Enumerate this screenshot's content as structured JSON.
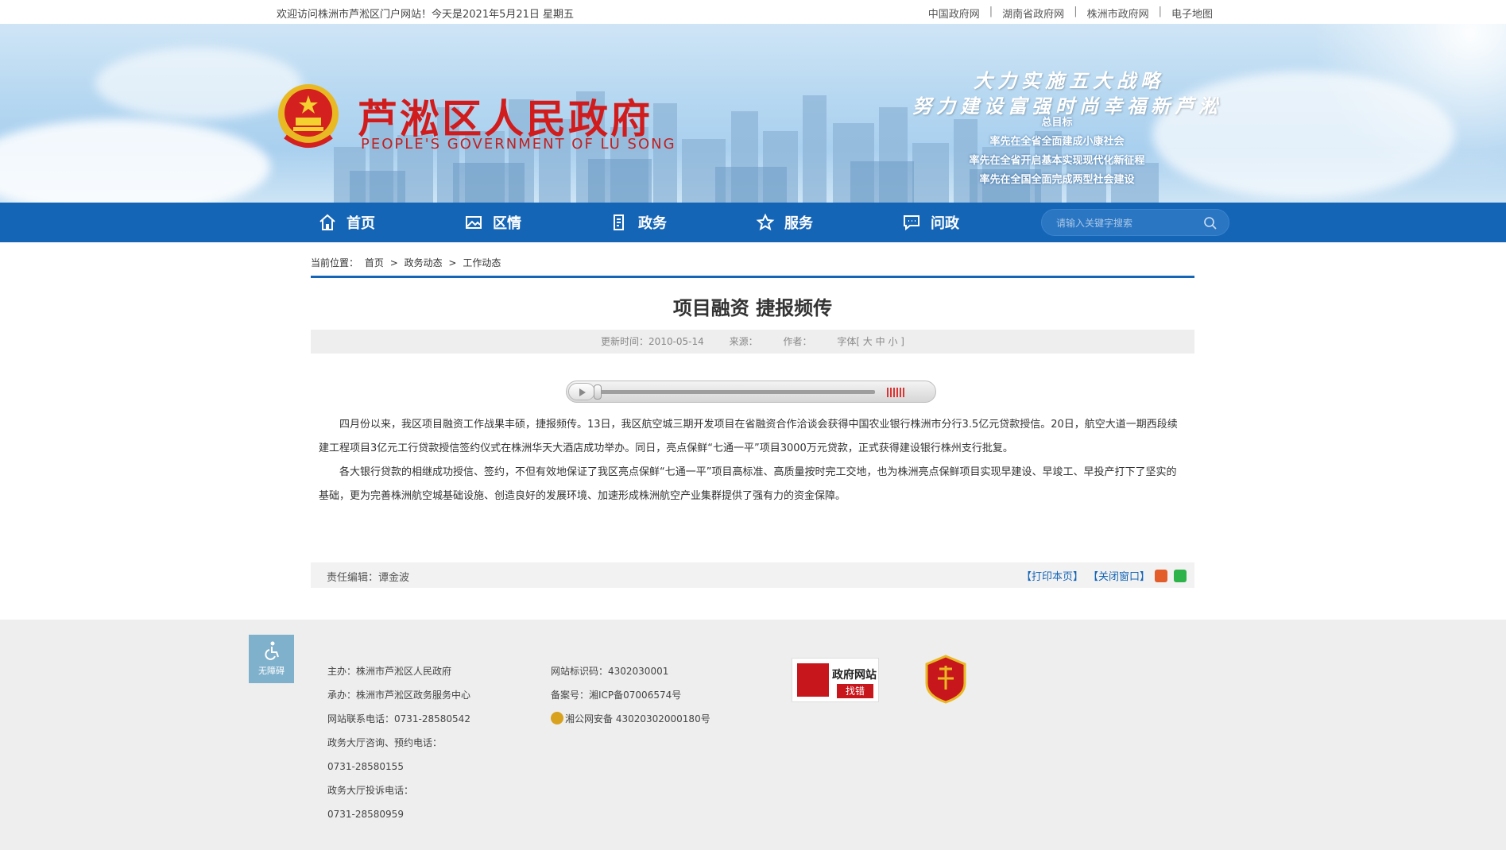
{
  "topbar": {
    "welcome": "欢迎访问株洲市芦淞区门户网站！今天是2021年5月21日 星期五",
    "links": [
      "中国政府网",
      "湖南省政府网",
      "株洲市政府网",
      "电子地图"
    ],
    "sep": "|"
  },
  "banner": {
    "title": "芦淞区人民政府",
    "subtitle": "PEOPLE'S GOVERNMENT OF  LU SONG",
    "slogan1": "大力实施五大战略",
    "slogan2": "努力建设富强时尚幸福新芦淞",
    "goals": [
      "总目标",
      "率先在全省全面建成小康社会",
      "率先在全省开启基本实现现代化新征程",
      "率先在全国全面完成两型社会建设"
    ]
  },
  "nav": {
    "items": [
      {
        "label": "首页",
        "icon": "home-icon"
      },
      {
        "label": "区情",
        "icon": "picture-icon"
      },
      {
        "label": "政务",
        "icon": "document-icon"
      },
      {
        "label": "服务",
        "icon": "star-icon"
      },
      {
        "label": "问政",
        "icon": "chat-icon"
      }
    ],
    "search_placeholder": "请输入关键字搜索"
  },
  "breadcrumb": {
    "prefix": "当前位置：",
    "items": [
      "首页",
      "政务动态",
      "工作动态"
    ],
    "sep": ">"
  },
  "article": {
    "title": "项目融资 捷报频传",
    "meta": {
      "updated": "更新时间：2010-05-14",
      "source": "来源：",
      "author": "作者：",
      "font": "字体[ 大 中 小 ]"
    },
    "paragraphs": [
      "四月份以来，我区项目融资工作战果丰硕，捷报频传。13日，我区航空城三期开发项目在省融资合作洽谈会获得中国农业银行株洲市分行3.5亿元贷款授信。20日，航空大道一期西段续建工程项目3亿元工行贷款授信签约仪式在株洲华天大酒店成功举办。同日，亮点保鲜“七通一平”项目3000万元贷款，正式获得建设银行株州支行批复。",
      "各大银行贷款的相继成功授信、签约，不但有效地保证了我区亮点保鲜“七通一平”项目高标准、高质量按时完工交地，也为株洲亮点保鲜项目实现早建设、早竣工、早投产打下了坚实的基础，更为完善株洲航空城基础设施、创造良好的发展环境、加速形成株洲航空产业集群提供了强有力的资金保障。"
    ],
    "editor": "责任编辑：谭金波",
    "print": "【打印本页】",
    "close": "【关闭窗口】"
  },
  "footer": {
    "accessibility": "无障碍",
    "col1": [
      "主办：株洲市芦淞区人民政府",
      "承办：株洲市芦淞区政务服务中心",
      "网站联系电话：0731-28580542",
      "政务大厅咨询、预约电话：",
      "0731-28580155",
      "政务大厅投诉电话：",
      "0731-28580959"
    ],
    "col2": [
      "网站标识码：4302030001",
      "备案号：湘ICP备07006574号",
      "湘公网安备 43020302000180号"
    ],
    "findwrong_title": "政府网站",
    "findwrong_button": "找错"
  },
  "colors": {
    "nav_blue": "#1565b7",
    "title_red": "#d01c1c",
    "footer_bg": "#eeeeee"
  }
}
